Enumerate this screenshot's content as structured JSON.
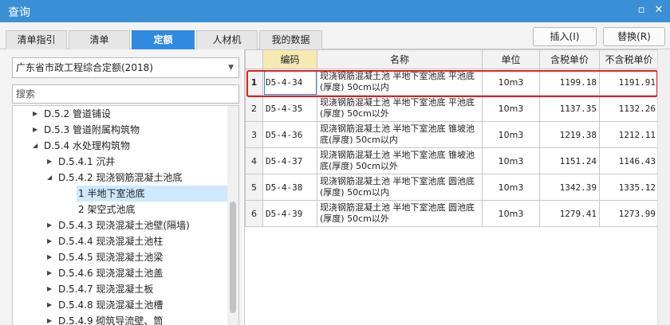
{
  "window": {
    "title": "查询",
    "restore_glyph": "▫",
    "close_glyph": "✕"
  },
  "tabs": [
    {
      "label": "清单指引"
    },
    {
      "label": "清单"
    },
    {
      "label": "定额"
    },
    {
      "label": "人材机"
    },
    {
      "label": "我的数据"
    }
  ],
  "active_tab": "定额",
  "buttons": {
    "insert": "插入(I)",
    "replace": "替换(R)"
  },
  "left": {
    "library_select": "广东省市政工程综合定额(2018)",
    "search_placeholder": "搜索",
    "tree": [
      {
        "text": "D.5.2 管道铺设",
        "expanded": false
      },
      {
        "text": "D.5.3 管道附属构筑物",
        "expanded": false
      },
      {
        "text": "D.5.4 水处理构筑物",
        "expanded": true
      },
      {
        "text": "D.5.4.1 沉井",
        "expanded": false
      },
      {
        "text": "D.5.4.2 现浇钢筋混凝土池底",
        "expanded": true
      },
      {
        "text": "1 半地下室池底",
        "selected": true
      },
      {
        "text": "2 架空式池底"
      },
      {
        "text": "D.5.4.3 现浇混凝土池壁(隔墙)",
        "expanded": false
      },
      {
        "text": "D.5.4.4 现浇混凝土池柱",
        "expanded": false
      },
      {
        "text": "D.5.4.5 现浇混凝土池梁",
        "expanded": false
      },
      {
        "text": "D.5.4.6 现浇混凝土池盖",
        "expanded": false
      },
      {
        "text": "D.5.4.7 现浇混凝土板",
        "expanded": false
      },
      {
        "text": "D.5.4.8 现浇混凝土池槽",
        "expanded": false
      },
      {
        "text": "D.5.4.9 砌筑导流壁、筒",
        "expanded": false
      }
    ]
  },
  "table": {
    "headers": [
      "",
      "编码",
      "名称",
      "单位",
      "含税单价",
      "不含税单价"
    ],
    "rows": [
      {
        "idx": "1",
        "code": "D5-4-34",
        "name": "现浇钢筋混凝土池 半地下室池底 平池底(厚度) 50cm以内",
        "unit": "10m3",
        "price_tax": "1199.18",
        "price_notax": "1191.91"
      },
      {
        "idx": "2",
        "code": "D5-4-35",
        "name": "现浇钢筋混凝土池 半地下室池底 平池底(厚度) 50cm以外",
        "unit": "10m3",
        "price_tax": "1137.35",
        "price_notax": "1132.26"
      },
      {
        "idx": "3",
        "code": "D5-4-36",
        "name": "现浇钢筋混凝土池 半地下室池底 锥坡池底(厚度) 50cm以内",
        "unit": "10m3",
        "price_tax": "1219.38",
        "price_notax": "1212.11"
      },
      {
        "idx": "4",
        "code": "D5-4-37",
        "name": "现浇钢筋混凝土池 半地下室池底 锥坡池底(厚度) 50cm以外",
        "unit": "10m3",
        "price_tax": "1151.24",
        "price_notax": "1146.43"
      },
      {
        "idx": "5",
        "code": "D5-4-38",
        "name": "现浇钢筋混凝土池 半地下室池底 圆池底(厚度) 50cm以内",
        "unit": "10m3",
        "price_tax": "1342.39",
        "price_notax": "1335.12"
      },
      {
        "idx": "6",
        "code": "D5-4-39",
        "name": "现浇钢筋混凝土池 半地下室池底 圆池底(厚度) 50cm以外",
        "unit": "10m3",
        "price_tax": "1279.41",
        "price_notax": "1273.99"
      }
    ]
  },
  "colors": {
    "titlebar": "#3b8fd4",
    "active_tab": "#2f8ae0",
    "highlight_box": "#e02020",
    "tree_selected": "#cde8ff"
  }
}
